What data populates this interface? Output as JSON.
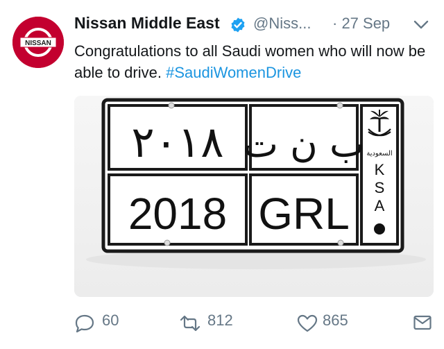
{
  "account": {
    "display_name": "Nissan Middle East",
    "handle": "@Niss...",
    "timestamp": "· 27 Sep",
    "avatar_logo_text": "NISSAN",
    "verified": true
  },
  "tweet": {
    "text": "Congratulations to all Saudi women who will now be able to drive. ",
    "hashtag": "#SaudiWomenDrive"
  },
  "image": {
    "plate_arabic_number": "٢٠١٨",
    "plate_arabic_letters": "ب ن ت",
    "plate_number": "2018",
    "plate_letters": "GRL",
    "country_arabic": "السعودية",
    "country_code_letters": [
      "K",
      "S",
      "A"
    ]
  },
  "actions": {
    "reply_count": "60",
    "retweet_count": "812",
    "like_count": "865"
  },
  "icons": {
    "reply": "reply-icon",
    "retweet": "retweet-icon",
    "like": "heart-icon",
    "dm": "mail-icon",
    "verified": "verified-badge-icon",
    "menu": "chevron-down-icon"
  },
  "colors": {
    "brand_red": "#c3002f",
    "link_blue": "#1b95e0",
    "verified_blue": "#1da1f2",
    "muted": "#657786"
  }
}
